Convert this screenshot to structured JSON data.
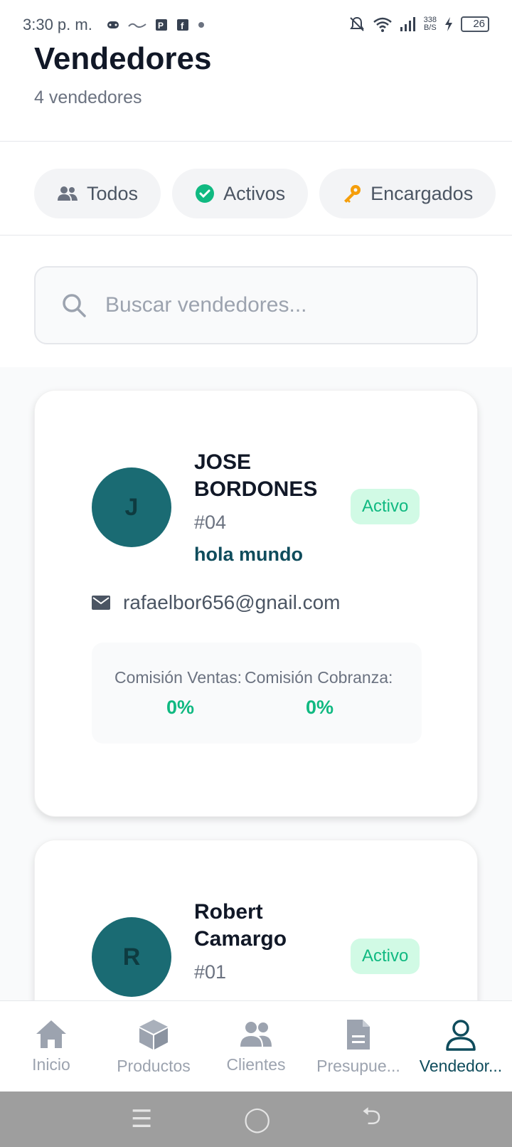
{
  "status_bar": {
    "time": "3:30 p. m.",
    "notif_icons": [
      "gamepad-icon",
      "brand-logo-icon",
      "parking-app-icon",
      "facebook-icon",
      "dot-icon"
    ],
    "net_speed_value": "338",
    "net_speed_unit": "B/S",
    "battery": "26"
  },
  "header": {
    "title": "Vendedores",
    "subtitle": "4 vendedores"
  },
  "filters": [
    {
      "label": "Todos",
      "icon": "users-icon",
      "icon_color": "#6b7280"
    },
    {
      "label": "Activos",
      "icon": "check-circle-icon",
      "icon_color": "#10b981"
    },
    {
      "label": "Encargados",
      "icon": "key-icon",
      "icon_color": "#f59e0b"
    }
  ],
  "search": {
    "placeholder": "Buscar vendedores..."
  },
  "sellers": [
    {
      "initial": "J",
      "name": "JOSE BORDONES",
      "code": "#04",
      "note": "hola mundo",
      "status": "Activo",
      "email": "rafaelbor656@gnail.com",
      "commission_sales_label": "Comisión Ventas:",
      "commission_sales_value": "0%",
      "commission_collection_label": "Comisión Cobranza:",
      "commission_collection_value": "0%"
    },
    {
      "initial": "R",
      "name": "Robert Camargo",
      "code": "#01",
      "status": "Activo"
    }
  ],
  "bottom_nav": [
    {
      "label": "Inicio",
      "icon": "home-icon",
      "active": false
    },
    {
      "label": "Productos",
      "icon": "box-icon",
      "active": false
    },
    {
      "label": "Clientes",
      "icon": "clients-icon",
      "active": false
    },
    {
      "label": "Presupue...",
      "icon": "document-icon",
      "active": false
    },
    {
      "label": "Vendedor...",
      "icon": "user-icon",
      "active": true
    }
  ],
  "colors": {
    "accent": "#0f4c5c",
    "avatar_bg": "#1a6b73",
    "success": "#10b981",
    "success_bg": "#d1fae5"
  }
}
